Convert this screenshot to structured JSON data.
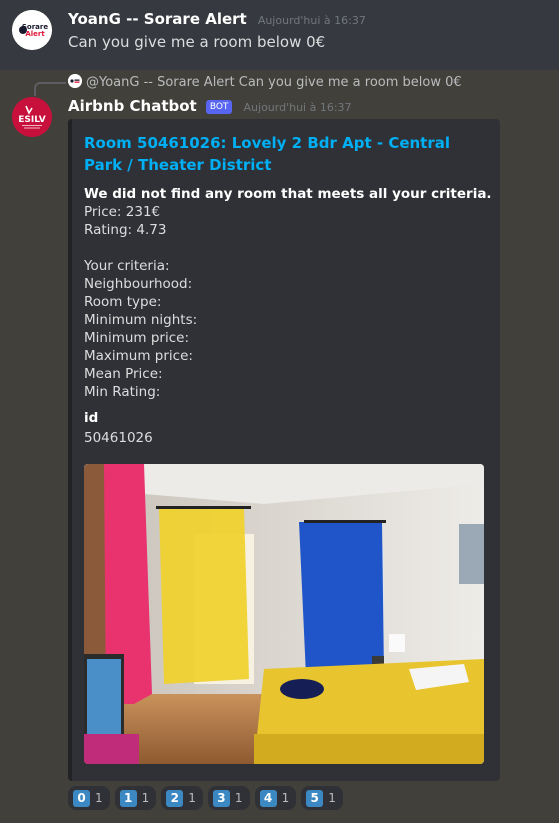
{
  "message1": {
    "author": "YoanG -- Sorare Alert",
    "timestamp": "Aujourd'hui à 16:37",
    "avatar_text": [
      "Sorare",
      "Alert"
    ],
    "content": "Can you give me a room below 0€"
  },
  "message2": {
    "reply": {
      "author": "@YoanG -- Sorare Alert",
      "content": "Can you give me a room below 0€"
    },
    "author": "Airbnb Chatbot",
    "bot_badge": "BOT",
    "timestamp": "Aujourd'hui à 16:37",
    "avatar_text": "ESILV",
    "embed": {
      "title": "Room 50461026: Lovely 2 Bdr Apt - Central Park / Theater District",
      "notice": "We did not find any room that meets all your criteria.",
      "price": "Price: 231€",
      "rating": "Rating: 4.73",
      "criteria_header": "Your criteria:",
      "criteria": [
        "Neighbourhood:",
        "Room type:",
        "Minimum nights:",
        "Minimum price:",
        "Maximum price:",
        "Mean Price:",
        "Min Rating:"
      ],
      "field_name": "id",
      "field_value": "50461026"
    },
    "reactions": [
      {
        "emoji": "0",
        "count": "1"
      },
      {
        "emoji": "1",
        "count": "1"
      },
      {
        "emoji": "2",
        "count": "1"
      },
      {
        "emoji": "3",
        "count": "1"
      },
      {
        "emoji": "4",
        "count": "1"
      },
      {
        "emoji": "5",
        "count": "1"
      }
    ]
  },
  "colors": {
    "background": "#36393f",
    "highlight": "#42403a",
    "embed_bg": "#2f3136",
    "link": "#00aff4",
    "bot_badge": "#5865f2",
    "keycap": "#3b88c3"
  }
}
